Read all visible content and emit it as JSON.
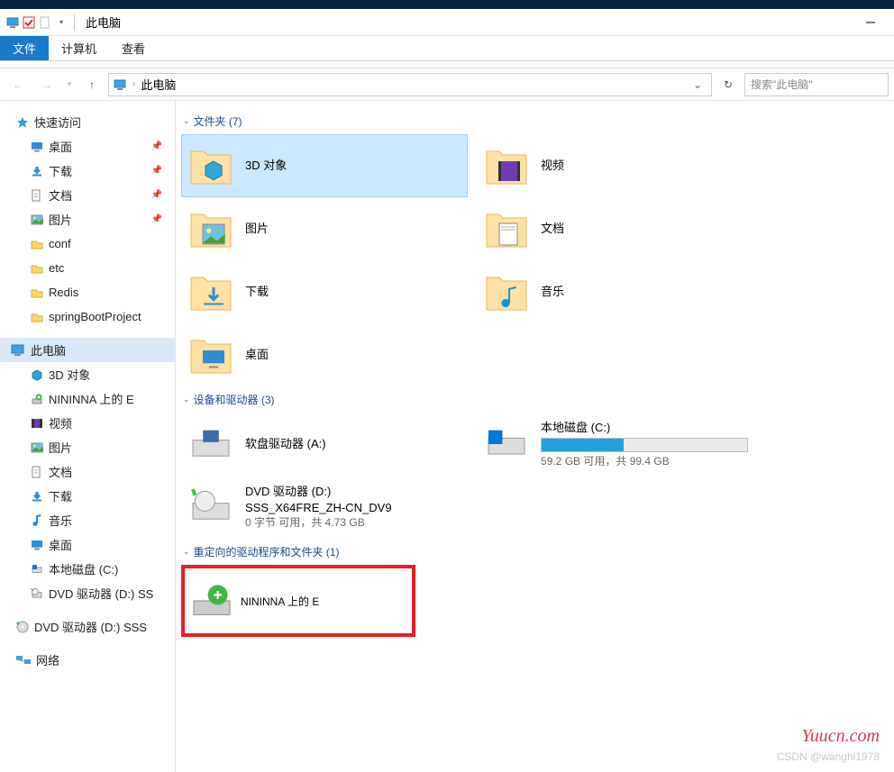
{
  "window": {
    "title": "此电脑"
  },
  "ribbon": {
    "file": "文件",
    "computer": "计算机",
    "view": "查看"
  },
  "nav": {
    "breadcrumb": "此电脑",
    "search_placeholder": "搜索\"此电脑\""
  },
  "sidebar": {
    "quick": {
      "label": "快速访问",
      "items": [
        {
          "label": "桌面",
          "pinned": true,
          "icon": "desktop"
        },
        {
          "label": "下载",
          "pinned": true,
          "icon": "download"
        },
        {
          "label": "文档",
          "pinned": true,
          "icon": "document"
        },
        {
          "label": "图片",
          "pinned": true,
          "icon": "pictures"
        },
        {
          "label": "conf",
          "icon": "folder"
        },
        {
          "label": "etc",
          "icon": "folder"
        },
        {
          "label": "Redis",
          "icon": "folder"
        },
        {
          "label": "springBootProject",
          "icon": "folder"
        }
      ]
    },
    "thispc": {
      "label": "此电脑",
      "items": [
        {
          "label": "3D 对象",
          "icon": "3d"
        },
        {
          "label": "NININNA 上的 E",
          "icon": "remote"
        },
        {
          "label": "视频",
          "icon": "video"
        },
        {
          "label": "图片",
          "icon": "pictures"
        },
        {
          "label": "文档",
          "icon": "document"
        },
        {
          "label": "下载",
          "icon": "download"
        },
        {
          "label": "音乐",
          "icon": "music"
        },
        {
          "label": "桌面",
          "icon": "desktop"
        },
        {
          "label": "本地磁盘 (C:)",
          "icon": "disk"
        },
        {
          "label": "DVD 驱动器 (D:) SS",
          "icon": "dvd"
        }
      ]
    },
    "dvd_item": {
      "label": "DVD 驱动器 (D:) SSS"
    },
    "network": {
      "label": "网络"
    }
  },
  "sections": {
    "folders": {
      "title": "文件夹 (7)",
      "items": [
        {
          "label": "3D 对象",
          "icon": "3d",
          "selected": true
        },
        {
          "label": "视频",
          "icon": "video"
        },
        {
          "label": "图片",
          "icon": "pictures"
        },
        {
          "label": "文档",
          "icon": "document"
        },
        {
          "label": "下载",
          "icon": "download"
        },
        {
          "label": "音乐",
          "icon": "music"
        },
        {
          "label": "桌面",
          "icon": "desktop"
        }
      ]
    },
    "devices": {
      "title": "设备和驱动器 (3)",
      "items": [
        {
          "label": "软盘驱动器 (A:)",
          "icon": "floppy"
        },
        {
          "label": "本地磁盘 (C:)",
          "icon": "disk",
          "free": "59.2 GB 可用，共 99.4 GB",
          "pct": 40
        },
        {
          "label": "DVD 驱动器 (D:)",
          "sub": "SSS_X64FRE_ZH-CN_DV9",
          "free": "0 字节 可用，共 4.73 GB",
          "icon": "dvd"
        }
      ]
    },
    "redirected": {
      "title": "重定向的驱动程序和文件夹 (1)",
      "items": [
        {
          "label": "NININNA 上的 E",
          "icon": "remote"
        }
      ]
    }
  },
  "watermark": "Yuucn.com",
  "csdn": "CSDN @wanghl1978"
}
